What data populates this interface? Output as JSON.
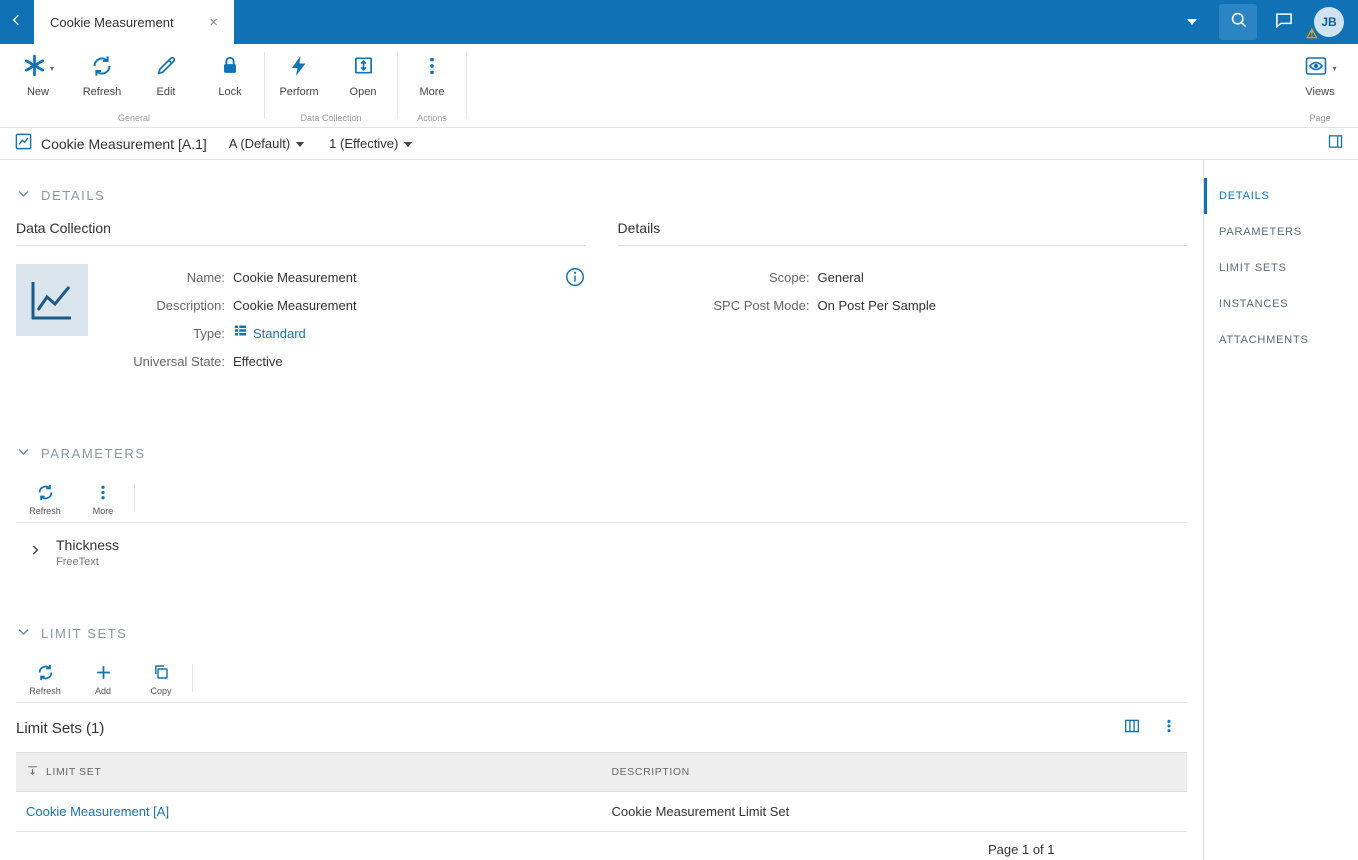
{
  "topbar": {
    "tab_title": "Cookie Measurement",
    "close_glyph": "×",
    "avatar_initials": "JB"
  },
  "ribbon": {
    "groups": [
      {
        "label": "General",
        "buttons": [
          {
            "label": "New"
          },
          {
            "label": "Refresh"
          },
          {
            "label": "Edit"
          },
          {
            "label": "Lock"
          }
        ]
      },
      {
        "label": "Data Collection",
        "buttons": [
          {
            "label": "Perform"
          },
          {
            "label": "Open"
          }
        ]
      },
      {
        "label": "Actions",
        "buttons": [
          {
            "label": "More"
          }
        ]
      },
      {
        "label": "Page",
        "buttons": [
          {
            "label": "Views"
          }
        ]
      }
    ]
  },
  "breadcrumb": {
    "title": "Cookie Measurement [A.1]",
    "version": "A (Default)",
    "state": "1 (Effective)"
  },
  "details": {
    "header": "DETAILS",
    "left_title": "Data Collection",
    "fields": [
      {
        "label": "Name:",
        "value": "Cookie Measurement"
      },
      {
        "label": "Description:",
        "value": "Cookie Measurement"
      },
      {
        "label": "Type:",
        "value": "Standard"
      },
      {
        "label": "Universal State:",
        "value": "Effective"
      }
    ],
    "right_title": "Details",
    "right_fields": [
      {
        "label": "Scope:",
        "value": "General"
      },
      {
        "label": "SPC Post Mode:",
        "value": "On Post Per Sample"
      }
    ]
  },
  "parameters": {
    "header": "PARAMETERS",
    "toolbar": {
      "refresh": "Refresh",
      "more": "More"
    },
    "items": [
      {
        "name": "Thickness",
        "type": "FreeText"
      }
    ]
  },
  "limit_sets": {
    "header": "LIMIT SETS",
    "toolbar": {
      "refresh": "Refresh",
      "add": "Add",
      "copy": "Copy"
    },
    "list_title": "Limit Sets (1)",
    "columns": {
      "limit_set": "LIMIT SET",
      "description": "DESCRIPTION"
    },
    "rows": [
      {
        "limit_set": "Cookie Measurement [A]",
        "description": "Cookie Measurement Limit Set"
      }
    ],
    "pagination": "Page 1 of 1"
  },
  "sidebar": {
    "items": [
      {
        "label": "DETAILS"
      },
      {
        "label": "PARAMETERS"
      },
      {
        "label": "LIMIT SETS"
      },
      {
        "label": "INSTANCES"
      },
      {
        "label": "ATTACHMENTS"
      }
    ]
  }
}
